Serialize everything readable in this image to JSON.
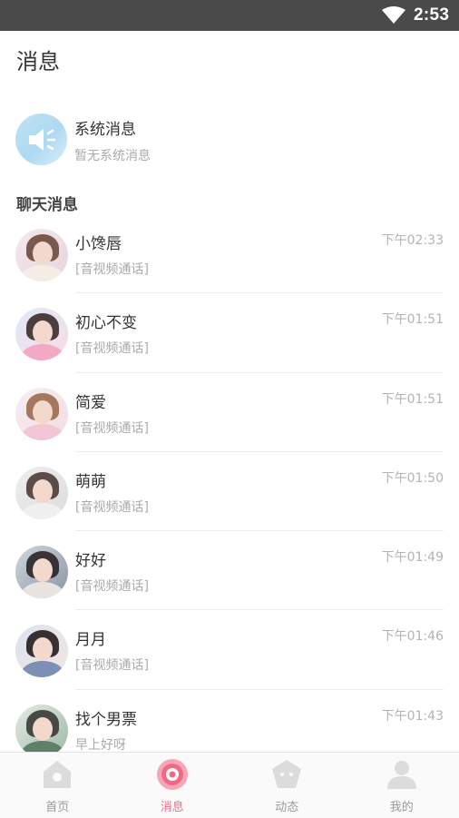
{
  "status_bar": {
    "time": "2:53"
  },
  "page_title": "消息",
  "system_message": {
    "title": "系统消息",
    "subtitle": "暂无系统消息"
  },
  "chat_section_title": "聊天消息",
  "chats": [
    {
      "name": "小馋唇",
      "time": "下午02:33",
      "preview": "[音视频通话]"
    },
    {
      "name": "初心不变",
      "time": "下午01:51",
      "preview": "[音视频通话]"
    },
    {
      "name": "简爱",
      "time": "下午01:51",
      "preview": "[音视频通话]"
    },
    {
      "name": "萌萌",
      "time": "下午01:50",
      "preview": "[音视频通话]"
    },
    {
      "name": "好好",
      "time": "下午01:49",
      "preview": "[音视频通话]"
    },
    {
      "name": "月月",
      "time": "下午01:46",
      "preview": "[音视频通话]"
    },
    {
      "name": "找个男票",
      "time": "下午01:43",
      "preview": "早上好呀"
    }
  ],
  "tabs": [
    {
      "label": "首页",
      "icon": "home-icon"
    },
    {
      "label": "消息",
      "icon": "message-icon",
      "active": true
    },
    {
      "label": "动态",
      "icon": "moments-icon"
    },
    {
      "label": "我的",
      "icon": "profile-icon"
    }
  ],
  "colors": {
    "accent": "#f06a86",
    "status_bar": "#4a4a4a",
    "inactive": "#999999"
  }
}
